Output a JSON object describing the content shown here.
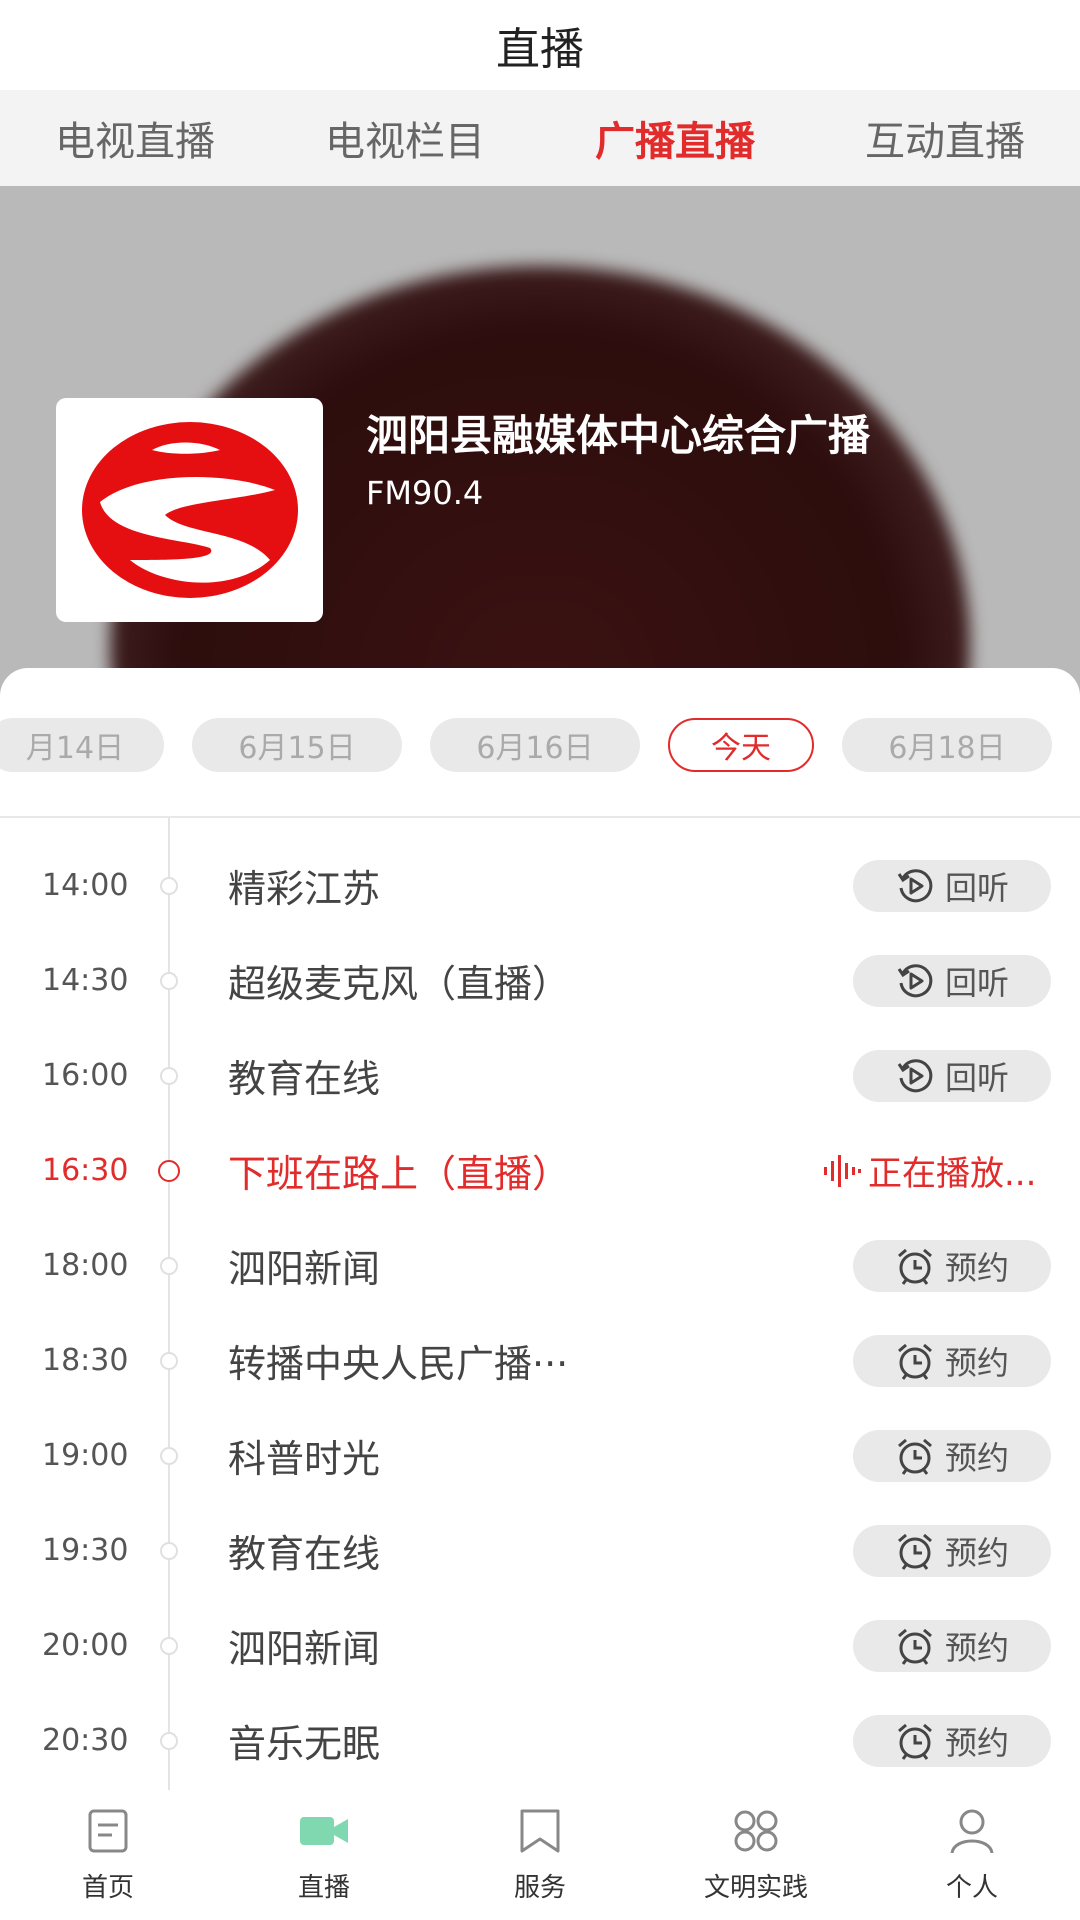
{
  "header": {
    "title": "直播"
  },
  "tabs": [
    {
      "label": "电视直播",
      "active": false
    },
    {
      "label": "电视栏目",
      "active": false
    },
    {
      "label": "广播直播",
      "active": true
    },
    {
      "label": "互动直播",
      "active": false
    }
  ],
  "station": {
    "name": "泗阳县融媒体中心综合广播",
    "frequency": "FM90.4"
  },
  "dates": [
    {
      "label": "月14日"
    },
    {
      "label": "6月15日"
    },
    {
      "label": "6月16日"
    },
    {
      "label": "今天",
      "selected": true
    },
    {
      "label": "6月18日"
    }
  ],
  "schedule": [
    {
      "time": "14:00",
      "name": "精彩江苏",
      "action": "回听",
      "action_icon": "replay-icon"
    },
    {
      "time": "14:30",
      "name": "超级麦克风（直播）",
      "action": "回听",
      "action_icon": "replay-icon"
    },
    {
      "time": "16:00",
      "name": "教育在线",
      "action": "回听",
      "action_icon": "replay-icon"
    },
    {
      "time": "16:30",
      "name": "下班在路上（直播）",
      "action": "正在播放...",
      "action_icon": "sound-wave-icon",
      "live": true
    },
    {
      "time": "18:00",
      "name": "泗阳新闻",
      "action": "预约",
      "action_icon": "alarm-clock-icon"
    },
    {
      "time": "18:30",
      "name": " 转播中央人民广播···",
      "action": "预约",
      "action_icon": "alarm-clock-icon"
    },
    {
      "time": "19:00",
      "name": "科普时光",
      "action": "预约",
      "action_icon": "alarm-clock-icon"
    },
    {
      "time": "19:30",
      "name": "教育在线",
      "action": "预约",
      "action_icon": "alarm-clock-icon"
    },
    {
      "time": "20:00",
      "name": "泗阳新闻",
      "action": "预约",
      "action_icon": "alarm-clock-icon"
    },
    {
      "time": "20:30",
      "name": "音乐无眠",
      "action": "预约",
      "action_icon": "alarm-clock-icon"
    }
  ],
  "bottom_nav": [
    {
      "label": "首页",
      "icon": "home-icon"
    },
    {
      "label": "直播",
      "icon": "video-camera-icon",
      "active": true
    },
    {
      "label": "服务",
      "icon": "bookmark-icon"
    },
    {
      "label": "文明实践",
      "icon": "grid-icon"
    },
    {
      "label": "个人",
      "icon": "person-icon"
    }
  ],
  "colors": {
    "accent": "#e22b2b",
    "nav_active": "#7fd8b0"
  }
}
